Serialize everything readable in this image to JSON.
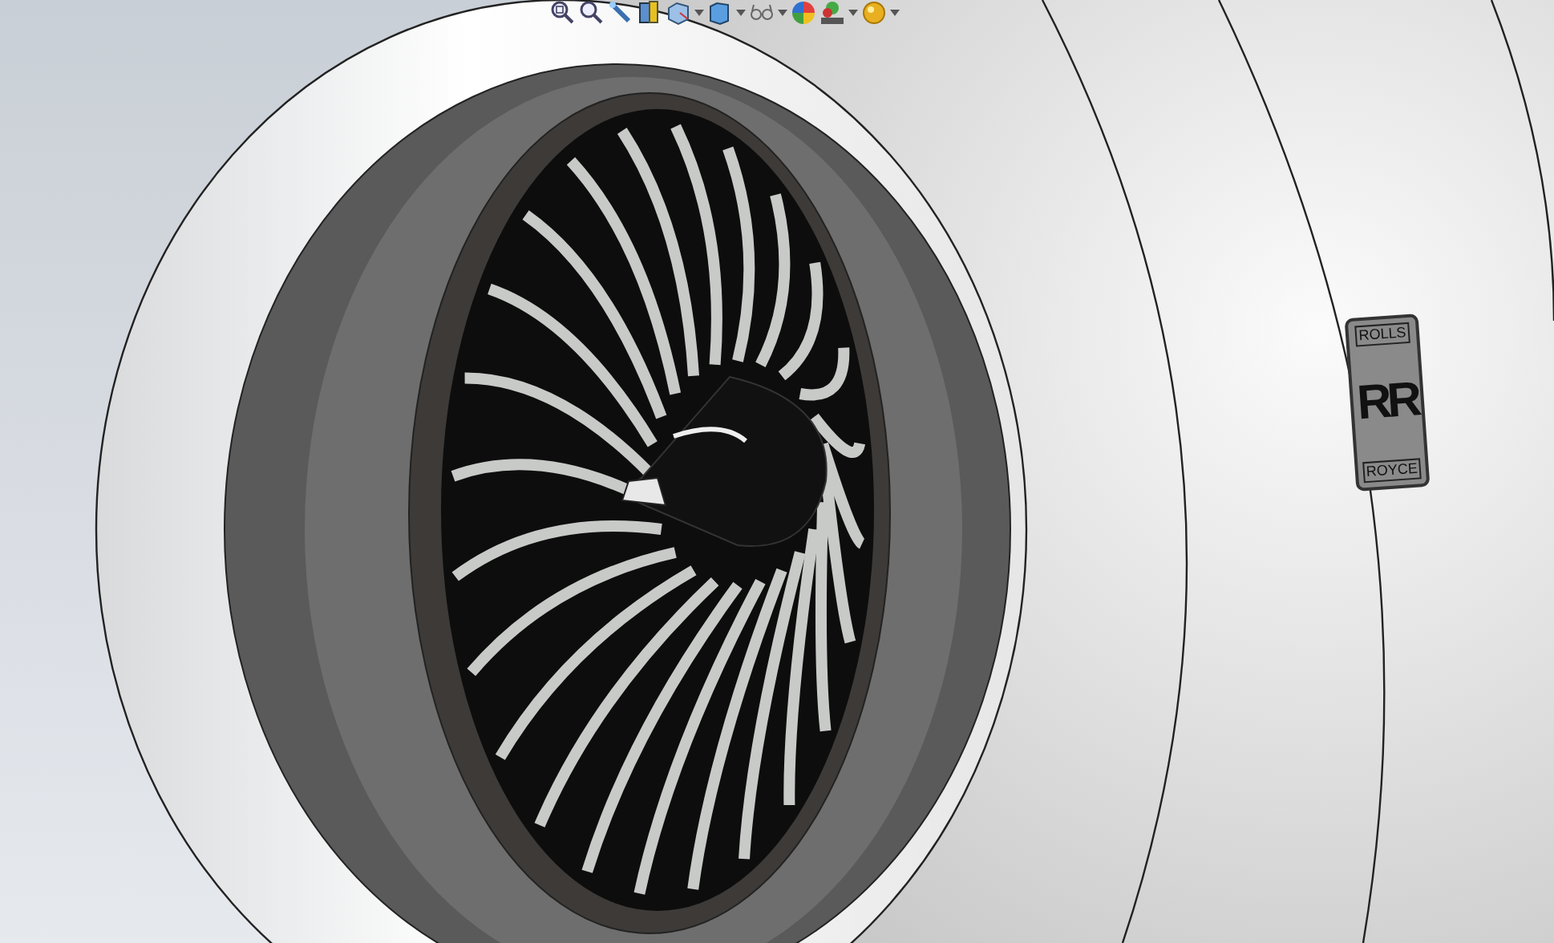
{
  "toolbar": {
    "buttons": [
      {
        "has_menu": false
      },
      {
        "has_menu": false
      },
      {
        "has_menu": false
      },
      {
        "has_menu": false
      },
      {
        "has_menu": true
      },
      {
        "has_menu": true
      },
      {
        "has_menu": true
      },
      {
        "has_menu": false
      },
      {
        "has_menu": true
      },
      {
        "has_menu": true
      }
    ]
  },
  "emblem": {
    "top": "ROLLS",
    "monogram": "RR",
    "bottom": "ROYCE"
  }
}
